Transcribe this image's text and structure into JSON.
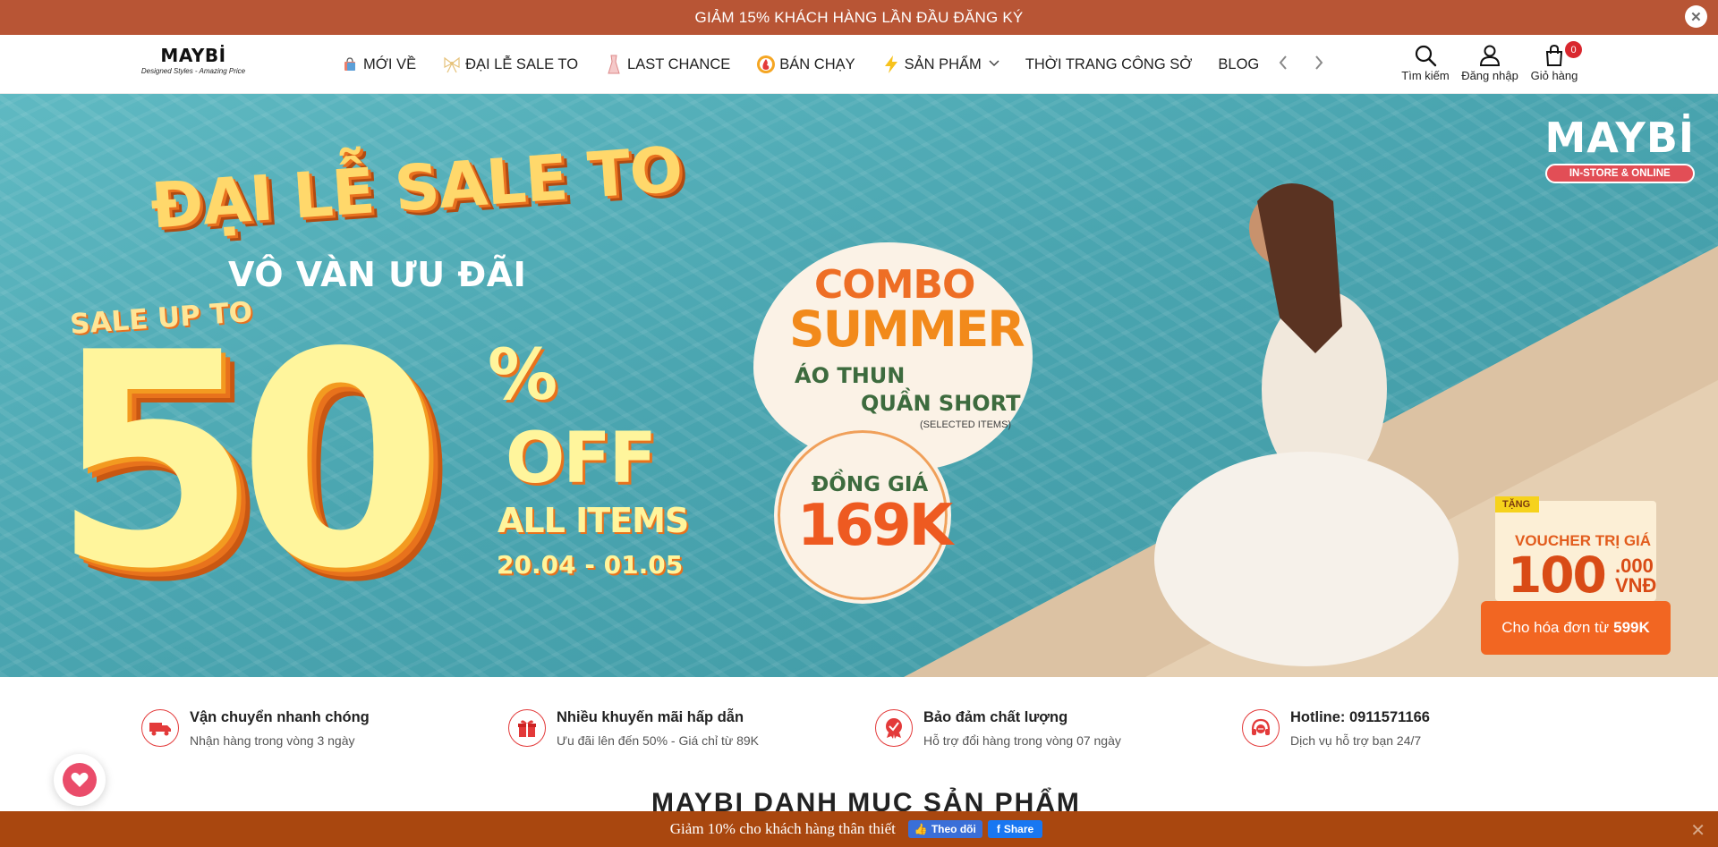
{
  "top_bar": {
    "text": "GIẢM 15% KHÁCH HÀNG LẦN ĐẦU ĐĂNG KÝ",
    "close": "✕"
  },
  "header": {
    "logo": {
      "brand": "MAYBİ",
      "tagline": "Designed Styles - Amazing Price"
    },
    "nav": [
      {
        "label": "MỚI VỀ",
        "icon": "shopping-bag-icon"
      },
      {
        "label": "ĐẠI LỄ SALE TO",
        "icon": "bow-icon"
      },
      {
        "label": "LAST CHANCE",
        "icon": "dress-icon"
      },
      {
        "label": "BÁN CHẠY",
        "icon": "hot-badge-icon"
      },
      {
        "label": "SẢN PHẨM",
        "icon": "lightning-icon"
      },
      {
        "label": "THỜI TRANG CÔNG SỞ"
      },
      {
        "label": "BLOG"
      }
    ],
    "actions": {
      "search": "Tìm kiếm",
      "login": "Đăng nhập",
      "cart": "Giỏ hàng",
      "cart_count": "0"
    }
  },
  "hero": {
    "logo": "MAYBİ",
    "logo_pill": "IN-STORE & ONLINE",
    "title": "ĐẠI LỄ SALE TO",
    "subtitle": "VÔ VÀN ƯU ĐÃI",
    "sale_up_to": "SALE UP TO",
    "big_number": "50",
    "percent": "%",
    "off": "OFF",
    "all_items": "ALL ITEMS",
    "date_range": "20.04 - 01.05",
    "combo": {
      "line1": "COMBO",
      "line2": "SUMMER",
      "line3": "ÁO THUN",
      "line4": "QUẦN SHORT",
      "line5": "(SELECTED ITEMS)",
      "price_label": "ĐỒNG GIÁ",
      "price": "169K"
    },
    "voucher": {
      "tag": "TẶNG",
      "title": "VOUCHER TRỊ GIÁ",
      "amount": "100",
      "amount_suffix_1": ".000",
      "amount_suffix_2": "VNĐ",
      "condition": "Cho hóa đơn từ",
      "condition_amount": "599K"
    }
  },
  "features": [
    {
      "title": "Vận chuyển nhanh chóng",
      "subtitle": "Nhận hàng trong vòng 3 ngày",
      "icon": "truck-icon"
    },
    {
      "title": "Nhiều khuyến mãi hấp dẫn",
      "subtitle": "Ưu đãi lên đến 50% - Giá chỉ từ 89K",
      "icon": "gift-icon"
    },
    {
      "title": "Bảo đảm chất lượng",
      "subtitle": "Hỗ trợ đổi hàng trong vòng 07 ngày",
      "icon": "quality-badge-icon"
    },
    {
      "title": "Hotline: 0911571166",
      "subtitle": "Dịch vụ hỗ trợ bạn 24/7",
      "icon": "headset-icon"
    }
  ],
  "section_heading": "MAYBI DANH MỤC SẢN PHẨM",
  "bottom_bar": {
    "text": "Giảm 10% cho khách hàng thân thiết",
    "follow": "Theo dõi",
    "share": "Share",
    "close": "✕"
  },
  "colors": {
    "top_bar": "#b85535",
    "bottom_bar": "#a9470f",
    "accent": "#e33a3a"
  }
}
